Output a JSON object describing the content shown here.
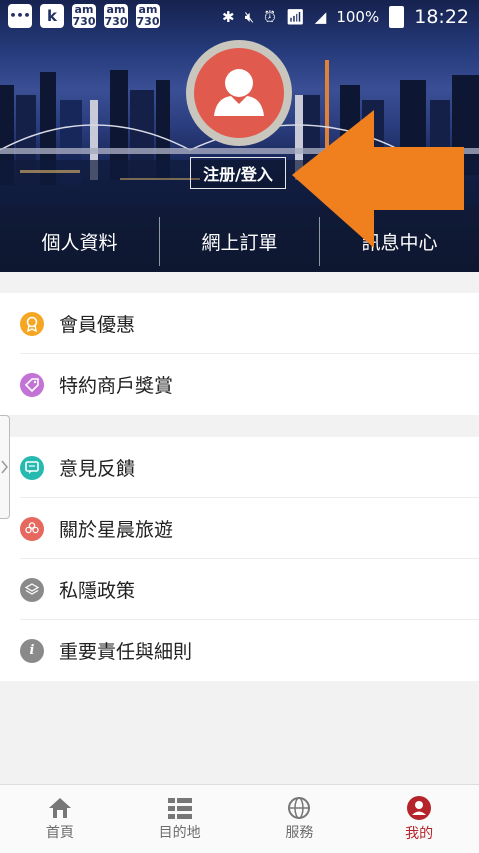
{
  "status_bar": {
    "left_icons": [
      "chat-bubble-icon",
      "k-app-icon",
      "am730-icon",
      "am730-icon",
      "am730-icon"
    ],
    "am730_label": "am\n730",
    "k_label": "k",
    "battery": "100%",
    "time": "18:22"
  },
  "header": {
    "login_label": "注册/登入",
    "tabs": [
      {
        "label": "個人資料"
      },
      {
        "label": "網上訂單"
      },
      {
        "label": "訊息中心"
      }
    ]
  },
  "menu_group_1": [
    {
      "label": "會員優惠",
      "icon": "award-icon",
      "color": "#f5a623"
    },
    {
      "label": "特約商戶獎賞",
      "icon": "tag-icon",
      "color": "#c372d6"
    }
  ],
  "menu_group_2": [
    {
      "label": "意見反饋",
      "icon": "chat-icon",
      "color": "#25b9b0"
    },
    {
      "label": "關於星晨旅遊",
      "icon": "flower-icon",
      "color": "#e6685e"
    },
    {
      "label": "私隱政策",
      "icon": "layers-icon",
      "color": "#8a8a8a"
    },
    {
      "label": "重要責任與細則",
      "icon": "info-icon",
      "color": "#8a8a8a",
      "glyph": "i"
    }
  ],
  "bottom_nav": [
    {
      "label": "首頁",
      "icon": "home-icon",
      "active": false
    },
    {
      "label": "目的地",
      "icon": "list-icon",
      "active": false
    },
    {
      "label": "服務",
      "icon": "globe-icon",
      "active": false
    },
    {
      "label": "我的",
      "icon": "user-icon",
      "active": true
    }
  ],
  "colors": {
    "accent": "#b5232b",
    "arrow": "#f07f1e"
  }
}
